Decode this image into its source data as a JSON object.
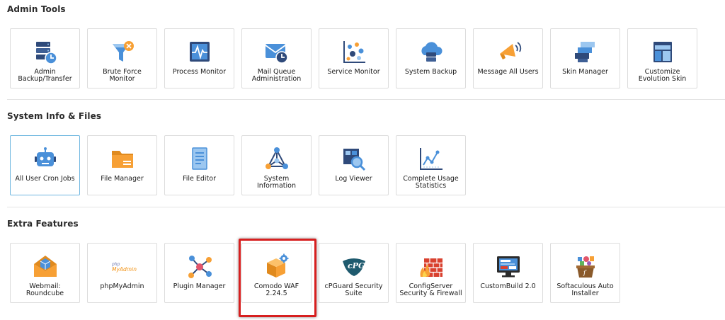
{
  "sections": {
    "admin": {
      "title": "Admin Tools",
      "tiles": [
        {
          "label": "Admin Backup/Transfer",
          "icon": "server-backup-icon"
        },
        {
          "label": "Brute Force Monitor",
          "icon": "funnel-filter-icon"
        },
        {
          "label": "Process Monitor",
          "icon": "pulse-monitor-icon"
        },
        {
          "label": "Mail Queue Administration",
          "icon": "mail-clock-icon"
        },
        {
          "label": "Service Monitor",
          "icon": "dots-chart-icon"
        },
        {
          "label": "System Backup",
          "icon": "cloud-backup-icon"
        },
        {
          "label": "Message All Users",
          "icon": "megaphone-icon"
        },
        {
          "label": "Skin Manager",
          "icon": "layers-skin-icon"
        },
        {
          "label": "Customize Evolution Skin",
          "icon": "layout-window-icon"
        }
      ]
    },
    "sysinfo": {
      "title": "System Info & Files",
      "tiles": [
        {
          "label": "All User Cron Jobs",
          "icon": "robot-icon"
        },
        {
          "label": "File Manager",
          "icon": "folder-icon"
        },
        {
          "label": "File Editor",
          "icon": "document-icon"
        },
        {
          "label": "System Information",
          "icon": "network-triangle-icon"
        },
        {
          "label": "Log Viewer",
          "icon": "magnifier-log-icon"
        },
        {
          "label": "Complete Usage Statistics",
          "icon": "line-chart-icon"
        }
      ]
    },
    "extra": {
      "title": "Extra Features",
      "tiles": [
        {
          "label": "Webmail: Roundcube",
          "icon": "envelope-cube-icon"
        },
        {
          "label": "phpMyAdmin",
          "icon": "phpmyadmin-logo-icon",
          "logo_text_top": "php",
          "logo_text_bottom": "MyAdmin"
        },
        {
          "label": "Plugin Manager",
          "icon": "plugin-nodes-icon"
        },
        {
          "label": "Comodo WAF 2.24.5",
          "icon": "box-gear-icon"
        },
        {
          "label": "cPGuard Security Suite",
          "icon": "cpguard-shield-icon",
          "logo_text": "cPG"
        },
        {
          "label": "ConfigServer Security & Firewall",
          "icon": "brick-firewall-icon"
        },
        {
          "label": "CustomBuild 2.0",
          "icon": "monitor-build-icon"
        },
        {
          "label": "Softaculous Auto Installer",
          "icon": "softaculous-icon"
        }
      ]
    }
  },
  "colors": {
    "icon_blue": "#4a90d9",
    "icon_navy": "#2f4a7a",
    "icon_orange": "#f7a035",
    "icon_light_blue": "#9cc7f0",
    "highlight_red": "#d71f1f",
    "active_border": "#6fb7e0"
  }
}
